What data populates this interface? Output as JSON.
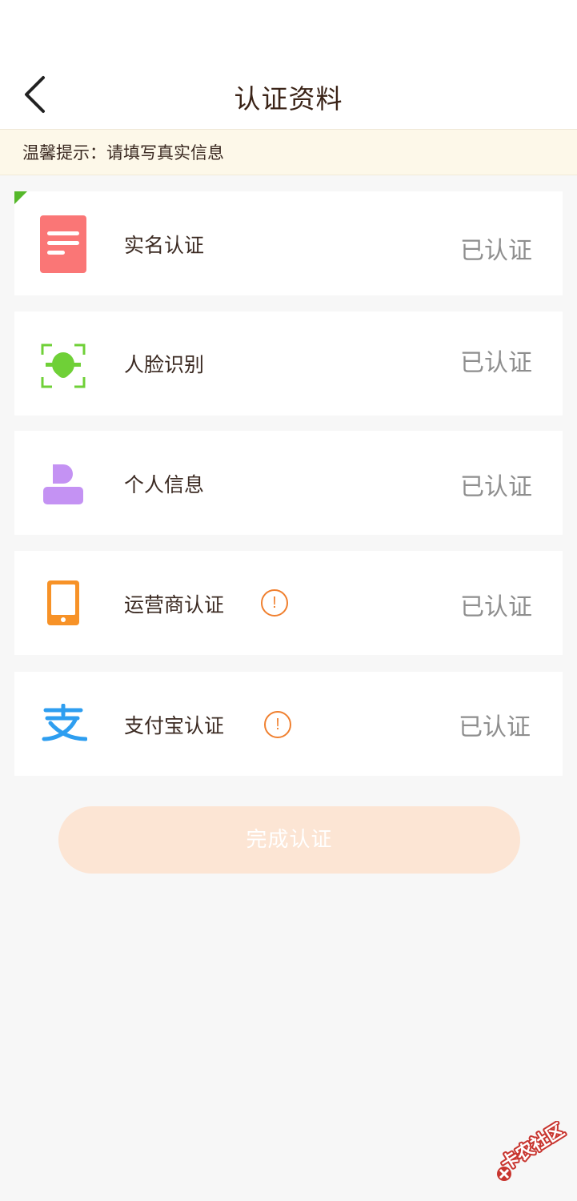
{
  "header": {
    "title": "认证资料"
  },
  "notice": {
    "text": "温馨提示：请填写真实信息"
  },
  "items": [
    {
      "label": "实名认证",
      "status": "已认证",
      "icon": "id-document-icon"
    },
    {
      "label": "人脸识别",
      "status": "已认证",
      "icon": "face-scan-icon"
    },
    {
      "label": "个人信息",
      "status": "已认证",
      "icon": "person-icon"
    },
    {
      "label": "运营商认证",
      "status": "已认证",
      "icon": "phone-icon",
      "warning": "!"
    },
    {
      "label": "支付宝认证",
      "status": "已认证",
      "icon": "alipay-icon",
      "warning": "!"
    }
  ],
  "submit": {
    "label": "完成认证"
  },
  "watermark": {
    "text": "卡农社区"
  },
  "colors": {
    "accent": "#f0802f",
    "button_bg": "#fce5d4",
    "notice_bg": "#fdf8e9"
  }
}
